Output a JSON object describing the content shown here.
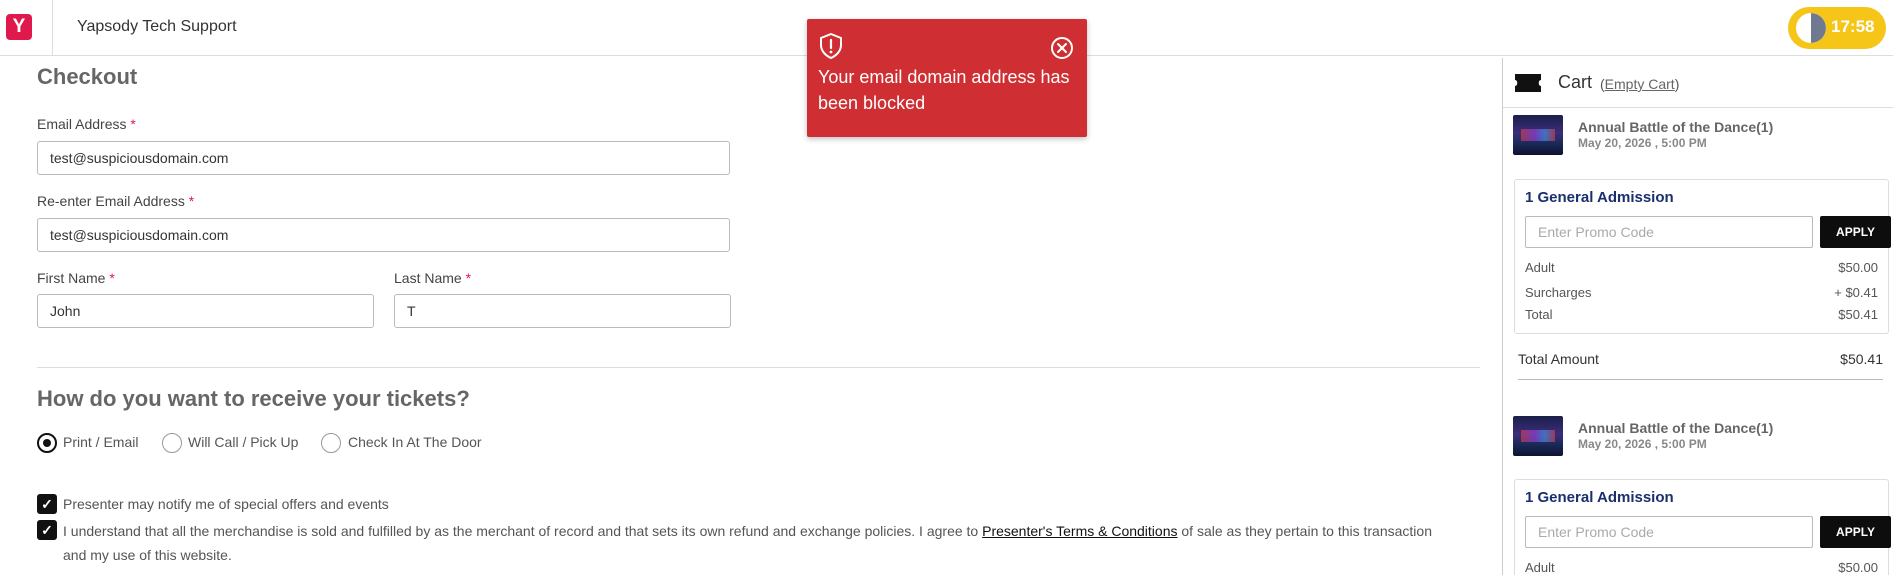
{
  "header": {
    "logo_letter": "Y",
    "site_title": "Yapsody Tech Support",
    "timer": "17:58"
  },
  "checkout": {
    "title": "Checkout",
    "email_label": "Email Address",
    "email_value": "test@suspiciousdomain.com",
    "reemail_label": "Re-enter Email Address",
    "reemail_value": "test@suspiciousdomain.com",
    "first_name_label": "First Name",
    "first_name_value": "John",
    "last_name_label": "Last Name",
    "last_name_value": "T",
    "required_mark": "*"
  },
  "delivery": {
    "title": "How do you want to receive your tickets?",
    "options": [
      {
        "label": "Print / Email",
        "selected": true
      },
      {
        "label": "Will Call / Pick Up",
        "selected": false
      },
      {
        "label": "Check In At The Door",
        "selected": false
      }
    ]
  },
  "consents": {
    "notify_label": "Presenter may notify me of special offers and events",
    "terms_prefix": "I understand that all the merchandise is sold and fulfilled by as the merchant of record and that sets its own refund and exchange policies. I agree to ",
    "terms_link": "Presenter's Terms & Conditions",
    "terms_suffix": " of sale as they pertain to this transaction and my use of this website.",
    "check_glyph": "✓"
  },
  "toast": {
    "message": "Your email domain address has been blocked",
    "bg_color": "#cf2f32"
  },
  "cart": {
    "title": "Cart",
    "empty_open": "(",
    "empty_label": "Empty Cart",
    "empty_close": ")",
    "items": [
      {
        "event_name": "Annual Battle of the Dance(1)",
        "event_date": "May 20, 2026 , 5:00 PM",
        "ticket_title": "1 General Admission",
        "promo_placeholder": "Enter Promo Code",
        "apply_label": "APPLY",
        "rows": [
          {
            "label": "Adult",
            "value": "$50.00"
          },
          {
            "label": "Surcharges",
            "value": "+ $0.41"
          },
          {
            "label": "Total",
            "value": "$50.41"
          }
        ]
      },
      {
        "event_name": "Annual Battle of the Dance(1)",
        "event_date": "May 20, 2026 , 5:00 PM",
        "ticket_title": "1 General Admission",
        "promo_placeholder": "Enter Promo Code",
        "apply_label": "APPLY",
        "rows": [
          {
            "label": "Adult",
            "value": "$50.00"
          }
        ]
      }
    ],
    "total_amount_label": "Total Amount",
    "total_amount_value": "$50.41"
  },
  "colors": {
    "brand": "#e0194d",
    "timer": "#f5c518",
    "ticket_title": "#1a2f6e"
  }
}
